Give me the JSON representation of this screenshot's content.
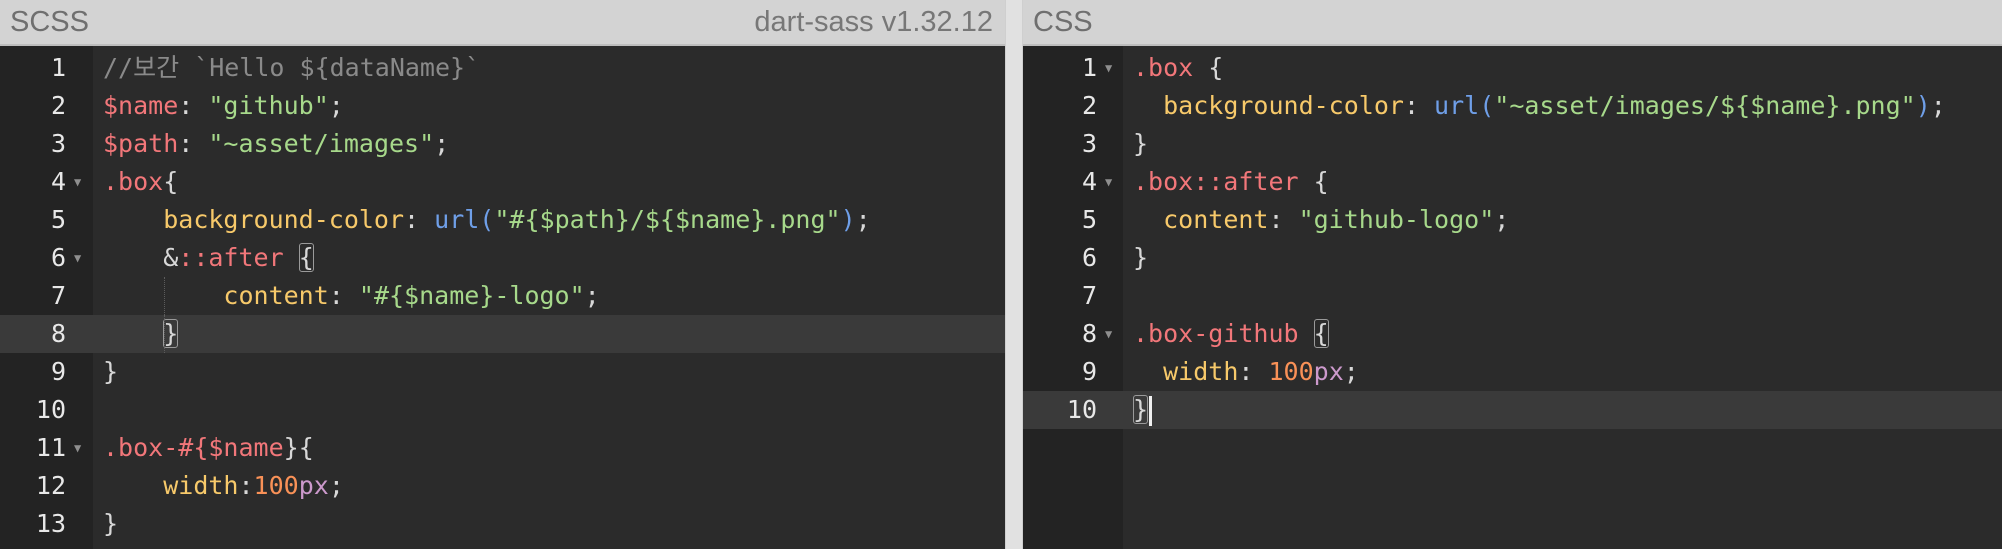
{
  "scss_pane": {
    "title": "SCSS",
    "compiler_label": "dart-sass v1.32.12",
    "lines": [
      {
        "num": "1",
        "tokens": [
          {
            "c": "cm",
            "t": "//보간 `Hello ${dataName}`"
          }
        ]
      },
      {
        "num": "2",
        "tokens": [
          {
            "c": "var",
            "t": "$name"
          },
          {
            "c": "punc",
            "t": ": "
          },
          {
            "c": "str",
            "t": "\"github\""
          },
          {
            "c": "punc",
            "t": ";"
          }
        ]
      },
      {
        "num": "3",
        "tokens": [
          {
            "c": "var",
            "t": "$path"
          },
          {
            "c": "punc",
            "t": ": "
          },
          {
            "c": "str",
            "t": "\"~asset/images\""
          },
          {
            "c": "punc",
            "t": ";"
          }
        ]
      },
      {
        "num": "4",
        "fold": true,
        "tokens": [
          {
            "c": "sel",
            "t": ".box"
          },
          {
            "c": "punc",
            "t": "{"
          }
        ]
      },
      {
        "num": "5",
        "tokens": [
          {
            "c": "punc",
            "t": "    "
          },
          {
            "c": "prop",
            "t": "background-color"
          },
          {
            "c": "punc",
            "t": ": "
          },
          {
            "c": "fn",
            "t": "url("
          },
          {
            "c": "str",
            "t": "\"#{$path}/${$name}.png\""
          },
          {
            "c": "fn",
            "t": ")"
          },
          {
            "c": "punc",
            "t": ";"
          }
        ]
      },
      {
        "num": "6",
        "fold": true,
        "tokens": [
          {
            "c": "punc",
            "t": "    &"
          },
          {
            "c": "sel",
            "t": "::after"
          },
          {
            "c": "punc",
            "t": " "
          },
          {
            "c": "punc brk",
            "t": "{"
          }
        ]
      },
      {
        "num": "7",
        "tokens": [
          {
            "c": "punc",
            "t": "        "
          },
          {
            "c": "prop",
            "t": "content"
          },
          {
            "c": "punc",
            "t": ": "
          },
          {
            "c": "str",
            "t": "\"#{$name}-logo\""
          },
          {
            "c": "punc",
            "t": ";"
          }
        ]
      },
      {
        "num": "8",
        "active": true,
        "tokens": [
          {
            "c": "punc",
            "t": "    "
          },
          {
            "c": "punc brk",
            "t": "}"
          }
        ]
      },
      {
        "num": "9",
        "tokens": [
          {
            "c": "punc",
            "t": "}"
          }
        ]
      },
      {
        "num": "10",
        "tokens": []
      },
      {
        "num": "11",
        "fold": true,
        "tokens": [
          {
            "c": "sel",
            "t": ".box-"
          },
          {
            "c": "var",
            "t": "#{"
          },
          {
            "c": "var",
            "t": "$name"
          },
          {
            "c": "punc",
            "t": "}{"
          }
        ]
      },
      {
        "num": "12",
        "tokens": [
          {
            "c": "punc",
            "t": "    "
          },
          {
            "c": "prop",
            "t": "width"
          },
          {
            "c": "punc",
            "t": ":"
          },
          {
            "c": "num",
            "t": "100"
          },
          {
            "c": "unit",
            "t": "px"
          },
          {
            "c": "punc",
            "t": ";"
          }
        ]
      },
      {
        "num": "13",
        "tokens": [
          {
            "c": "punc",
            "t": "}"
          }
        ]
      }
    ]
  },
  "css_pane": {
    "title": "CSS",
    "lines": [
      {
        "num": "1",
        "fold": true,
        "tokens": [
          {
            "c": "sel",
            "t": ".box"
          },
          {
            "c": "punc",
            "t": " {"
          }
        ]
      },
      {
        "num": "2",
        "tokens": [
          {
            "c": "punc",
            "t": "  "
          },
          {
            "c": "prop",
            "t": "background-color"
          },
          {
            "c": "punc",
            "t": ": "
          },
          {
            "c": "fn",
            "t": "url("
          },
          {
            "c": "str",
            "t": "\"~asset/images/${$name}.png\""
          },
          {
            "c": "fn",
            "t": ")"
          },
          {
            "c": "punc",
            "t": ";"
          }
        ]
      },
      {
        "num": "3",
        "tokens": [
          {
            "c": "punc",
            "t": "}"
          }
        ]
      },
      {
        "num": "4",
        "fold": true,
        "tokens": [
          {
            "c": "sel",
            "t": ".box::after"
          },
          {
            "c": "punc",
            "t": " {"
          }
        ]
      },
      {
        "num": "5",
        "tokens": [
          {
            "c": "punc",
            "t": "  "
          },
          {
            "c": "prop",
            "t": "content"
          },
          {
            "c": "punc",
            "t": ": "
          },
          {
            "c": "str",
            "t": "\"github-logo\""
          },
          {
            "c": "punc",
            "t": ";"
          }
        ]
      },
      {
        "num": "6",
        "tokens": [
          {
            "c": "punc",
            "t": "}"
          }
        ]
      },
      {
        "num": "7",
        "tokens": []
      },
      {
        "num": "8",
        "fold": true,
        "tokens": [
          {
            "c": "sel",
            "t": ".box-github"
          },
          {
            "c": "punc",
            "t": " "
          },
          {
            "c": "punc brk",
            "t": "{"
          }
        ]
      },
      {
        "num": "9",
        "tokens": [
          {
            "c": "punc",
            "t": "  "
          },
          {
            "c": "prop",
            "t": "width"
          },
          {
            "c": "punc",
            "t": ": "
          },
          {
            "c": "num",
            "t": "100"
          },
          {
            "c": "unit",
            "t": "px"
          },
          {
            "c": "punc",
            "t": ";"
          }
        ]
      },
      {
        "num": "10",
        "active": true,
        "cursor": true,
        "tokens": [
          {
            "c": "punc brk",
            "t": "}"
          }
        ]
      }
    ]
  },
  "icons": {
    "fold_marker": "fold-arrow-icon",
    "cursor": "text-cursor-icon"
  },
  "colors": {
    "editor_bg": "#2b2b2b",
    "gutter_bg": "#232323",
    "header_bg": "#d3d3d3",
    "variable": "#f2777a",
    "string": "#a7d98b",
    "property": "#f7c96a",
    "function": "#6f9fe8",
    "number": "#f99157",
    "unit": "#cc99cc",
    "comment": "#8a8a8a"
  }
}
